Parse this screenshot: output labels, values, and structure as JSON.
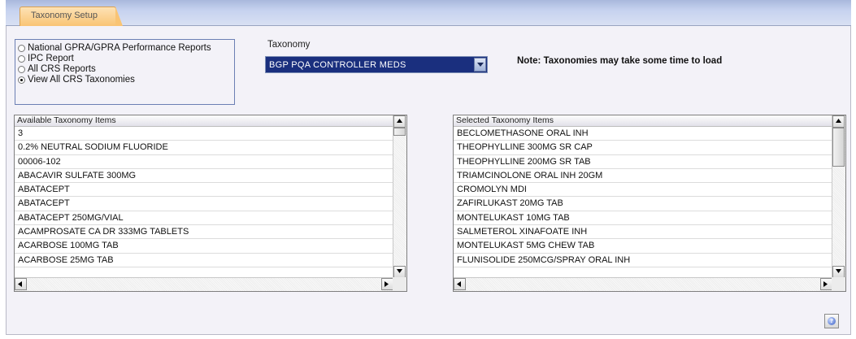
{
  "tab": {
    "label": "Taxonomy Setup"
  },
  "report_options": [
    {
      "label": "National GPRA/GPRA Performance Reports",
      "selected": false
    },
    {
      "label": "IPC Report",
      "selected": false
    },
    {
      "label": "All CRS Reports",
      "selected": false
    },
    {
      "label": "View All CRS Taxonomies",
      "selected": true
    }
  ],
  "taxonomy": {
    "label": "Taxonomy",
    "selected_value": "BGP PQA CONTROLLER MEDS"
  },
  "note": "Note:  Taxonomies may take some time to load",
  "available": {
    "header": "Available Taxonomy Items",
    "items": [
      "3",
      "0.2% NEUTRAL SODIUM FLUORIDE",
      "00006-102",
      "ABACAVIR SULFATE 300MG",
      "ABATACEPT",
      "ABATACEPT",
      "ABATACEPT 250MG/VIAL",
      "ACAMPROSATE CA DR 333MG TABLETS",
      "ACARBOSE 100MG TAB",
      "ACARBOSE 25MG TAB"
    ]
  },
  "selected": {
    "header": "Selected Taxonomy Items",
    "items": [
      "BECLOMETHASONE ORAL INH",
      "THEOPHYLLINE 300MG SR CAP",
      "THEOPHYLLINE 200MG SR TAB",
      "TRIAMCINOLONE ORAL INH 20GM",
      "CROMOLYN MDI",
      "ZAFIRLUKAST 20MG TAB",
      "MONTELUKAST 10MG TAB",
      "SALMETEROL XINAFOATE INH",
      "MONTELUKAST 5MG CHEW TAB",
      "FLUNISOLIDE 250MCG/SPRAY ORAL INH"
    ]
  },
  "icons": {
    "help": "help-icon",
    "dropdown": "chevron-down-icon"
  },
  "colors": {
    "combo_background": "#1a2f7e",
    "tab_background": "#f9c474",
    "header_band": "#c6d2ef"
  }
}
